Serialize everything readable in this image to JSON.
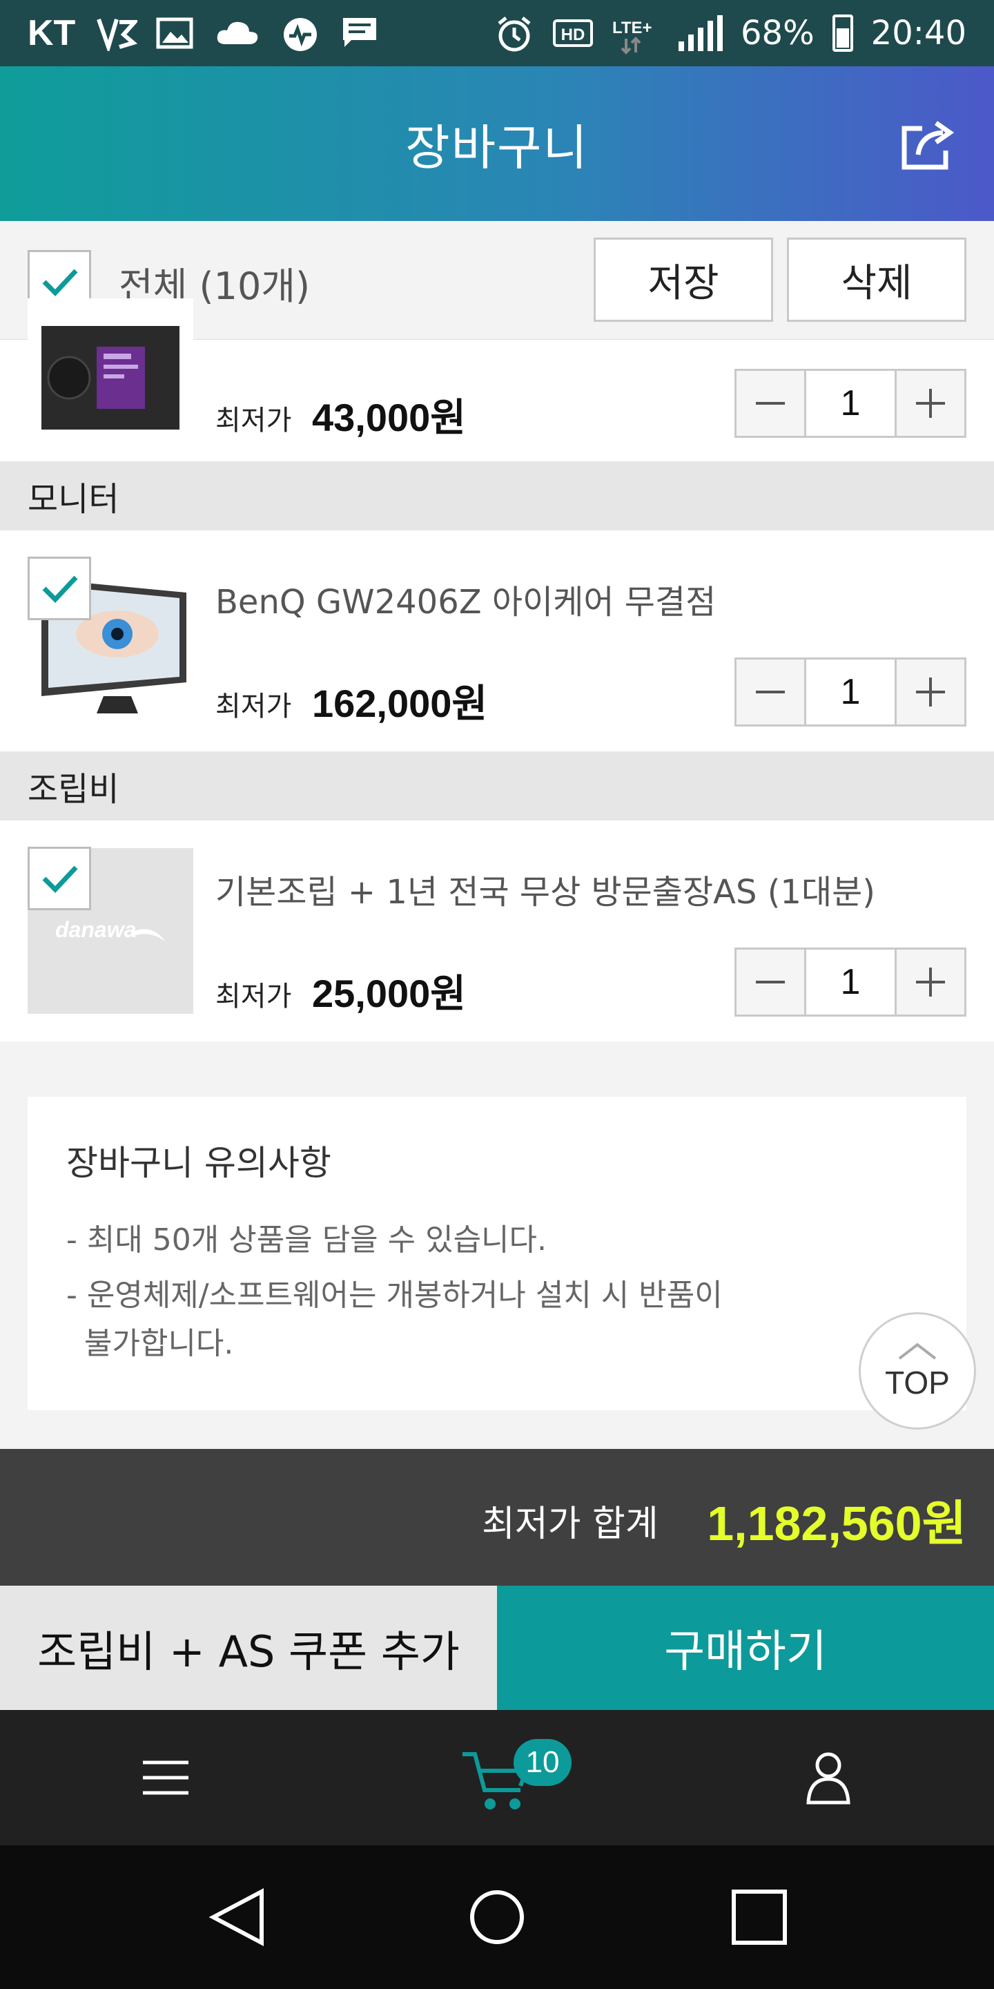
{
  "status_bar": {
    "carrier": "KT",
    "network": "LTE+",
    "battery": "68%",
    "time": "20:40",
    "icons": [
      "v3-icon",
      "gallery-icon",
      "cloud-icon",
      "health-icon",
      "message-icon",
      "alarm-icon",
      "hd-icon",
      "lte-icon",
      "signal-icon",
      "battery-icon"
    ]
  },
  "header": {
    "title": "장바구니",
    "share_icon": "share-icon"
  },
  "toolbar": {
    "select_all_label": "전체 (10개)",
    "select_all_checked": true,
    "save_label": "저장",
    "delete_label": "삭제"
  },
  "items": [
    {
      "name": "",
      "price_label": "최저가",
      "price": "43,000원",
      "quantity": "1",
      "checked": true
    },
    {
      "category": "모니터",
      "name": "BenQ GW2406Z 아이케어 무결점",
      "price_label": "최저가",
      "price": "162,000원",
      "quantity": "1",
      "checked": true
    },
    {
      "category": "조립비",
      "name": "기본조립 + 1년 전국 무상 방문출장AS (1대분)",
      "thumb_logo": "danawa",
      "price_label": "최저가",
      "price": "25,000원",
      "quantity": "1",
      "checked": true
    }
  ],
  "notice": {
    "title": "장바구니 유의사항",
    "line1": "- 최대 50개 상품을 담을 수 있습니다.",
    "line2a": "- 운영체제/소프트웨어는 개봉하거나 설치 시 반품이",
    "line2b": "불가합니다."
  },
  "top_button": {
    "label": "TOP"
  },
  "total": {
    "label": "최저가 합계",
    "value": "1,182,560원"
  },
  "actions": {
    "coupon_label": "조립비 + AS 쿠폰 추가",
    "buy_label": "구매하기"
  },
  "bottom_nav": {
    "cart_count": "10",
    "icons": [
      "menu-icon",
      "cart-icon",
      "user-icon"
    ]
  },
  "system_nav": {
    "icons": [
      "back-icon",
      "home-icon",
      "recents-icon"
    ]
  },
  "colors": {
    "accent": "#0d9a9a",
    "total_value": "#e4ff2a",
    "header_start": "#0f9d9a",
    "header_end": "#4c59c9"
  }
}
